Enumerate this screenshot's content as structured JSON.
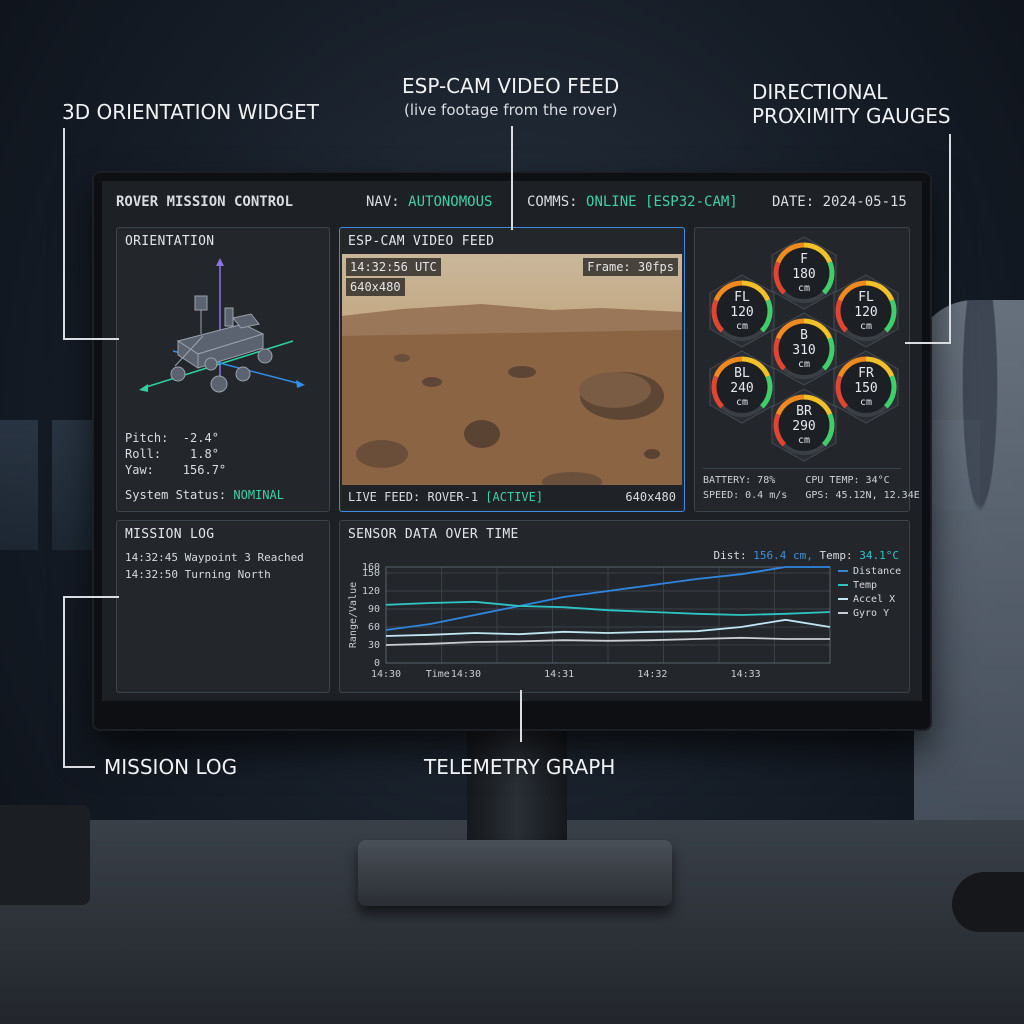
{
  "callouts": {
    "orientation": "3D ORIENTATION WIDGET",
    "video_title": "ESP-CAM VIDEO FEED",
    "video_sub": "(live footage from the rover)",
    "gauges_line1": "DIRECTIONAL",
    "gauges_line2": "PROXIMITY GAUGES",
    "mission_log": "MISSION LOG",
    "telemetry": "TELEMETRY GRAPH"
  },
  "header": {
    "title": "ROVER MISSION CONTROL",
    "nav_label": "NAV:",
    "nav_value": "AUTONOMOUS",
    "comms_label": "COMMS:",
    "comms_value": "ONLINE [ESP32-CAM]",
    "date": "DATE: 2024-05-15"
  },
  "orientation": {
    "title": "ORIENTATION",
    "pitch": "Pitch:  -2.4°",
    "roll": "Roll:    1.8°",
    "yaw": "Yaw:    156.7°",
    "status_label": "System Status:",
    "status_value": "NOMINAL"
  },
  "video": {
    "title": "ESP-CAM VIDEO FEED",
    "timestamp": "14:32:56 UTC",
    "frame": "Frame: 30fps",
    "resolution_top": "640x480",
    "feed_label": "LIVE FEED: ROVER-1",
    "feed_status": "[ACTIVE]",
    "resolution_bottom": "640x480"
  },
  "gauges": [
    {
      "id": "F",
      "label": "F",
      "value": "180",
      "unit": "cm",
      "level": 0.6
    },
    {
      "id": "FL",
      "label": "FL",
      "value": "120",
      "unit": "cm",
      "level": 0.4
    },
    {
      "id": "FL2",
      "label": "FL",
      "value": "120",
      "unit": "cm",
      "level": 0.4
    },
    {
      "id": "B",
      "label": "B",
      "value": "310",
      "unit": "cm",
      "level": 0.9
    },
    {
      "id": "BL",
      "label": "BL",
      "value": "240",
      "unit": "cm",
      "level": 0.7
    },
    {
      "id": "FR",
      "label": "FR",
      "value": "150",
      "unit": "cm",
      "level": 0.5
    },
    {
      "id": "BR",
      "label": "BR",
      "value": "290",
      "unit": "cm",
      "level": 0.85
    }
  ],
  "stats": {
    "line1": "BATTERY: 78%     CPU TEMP: 34°C",
    "line2": "SPEED: 0.4 m/s   GPS: 45.12N, 12.34E"
  },
  "mission_log": {
    "title": "MISSION LOG",
    "entries": [
      "14:32:45 Waypoint 3 Reached",
      "14:32:50 Turning North"
    ]
  },
  "graph": {
    "title": "SENSOR DATA OVER TIME",
    "readout_dist_label": "Dist:",
    "readout_dist_value": "156.4 cm,",
    "readout_temp_label": "Temp:",
    "readout_temp_value": "34.1°C"
  },
  "chart_data": {
    "type": "line",
    "title": "SENSOR DATA OVER TIME",
    "xlabel": "Time",
    "ylabel": "Range/Value",
    "ylim": [
      0,
      160
    ],
    "yticks": [
      0,
      30,
      60,
      90,
      120,
      150,
      160
    ],
    "xtick_labels": [
      "14:30",
      "14:30",
      "14:31",
      "14:32",
      "14:33"
    ],
    "x": [
      0,
      1,
      2,
      3,
      4,
      5,
      6,
      7,
      8,
      9,
      10
    ],
    "series": [
      {
        "name": "Distance",
        "color": "#2f86e0",
        "values": [
          55,
          65,
          80,
          95,
          110,
          120,
          130,
          140,
          148,
          160,
          160
        ]
      },
      {
        "name": "Temp",
        "color": "#2ec4c4",
        "values": [
          97,
          100,
          102,
          95,
          93,
          88,
          85,
          82,
          80,
          82,
          85
        ]
      },
      {
        "name": "Accel X",
        "color": "#bfe6f2",
        "values": [
          45,
          47,
          50,
          48,
          52,
          50,
          52,
          53,
          60,
          72,
          60
        ]
      },
      {
        "name": "Gyro Y",
        "color": "#c9ccd0",
        "values": [
          30,
          32,
          35,
          36,
          38,
          37,
          38,
          40,
          42,
          40,
          40
        ]
      }
    ],
    "legend": "top-right",
    "grid": true
  }
}
